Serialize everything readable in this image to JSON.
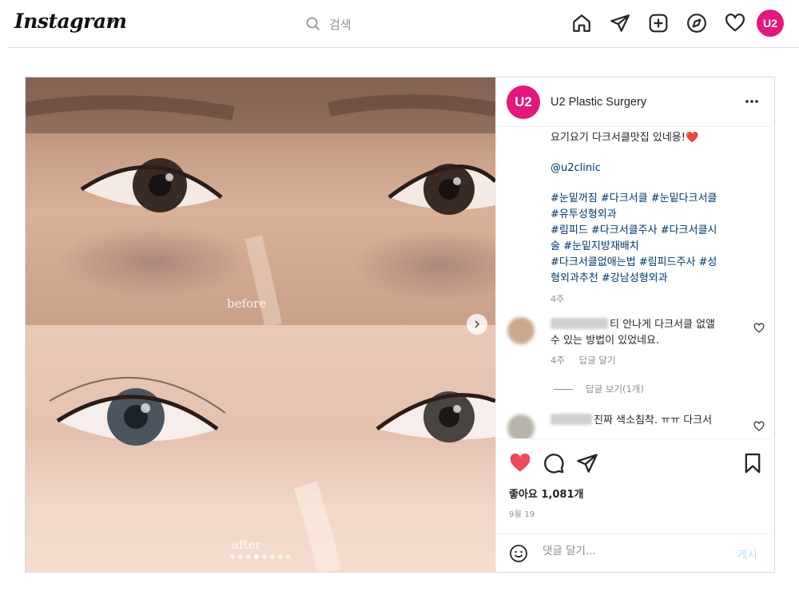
{
  "nav": {
    "logo": "Instagram",
    "search_placeholder": "검색",
    "avatar_text": "U2"
  },
  "post": {
    "before_label": "before",
    "after_label": "after",
    "carousel": {
      "total": 8,
      "active": 4
    },
    "account": {
      "avatar_text": "U2",
      "name": "U2 Plastic Surgery"
    },
    "caption": {
      "line1": "요기요기 다크서클맛집 있네용!",
      "heart_emoji": "❤️",
      "mention": "@u2clinic",
      "hashtags": [
        "#눈밑꺼짐 #다크서클 #눈밑다크서클",
        "#유투성형외과",
        "#림피드 #다크서클주사 #다크서클시",
        "술 #눈밑지방재배치",
        "#다크서클없애는법 #림피드주사 #성",
        "형외과추천 #강남성형외과"
      ],
      "time": "4주"
    },
    "comments": [
      {
        "text_line1": "티 안나게 다크서클 없앨",
        "text_line2": "수 있는 방법이 있었네요.",
        "time": "4주",
        "reply": "답글 달기",
        "view_replies": "답글 보기(1개)"
      },
      {
        "text_line1": "진짜 색소침착. ㅠㅠ 다크서"
      }
    ],
    "likes": "좋아요 1,081개",
    "date": "9월 19",
    "composer": {
      "placeholder": "댓글 달기...",
      "post_label": "게시"
    },
    "colors": {
      "like_active": "#ed4956",
      "link": "#00376b",
      "brand": "#e4187a"
    }
  }
}
